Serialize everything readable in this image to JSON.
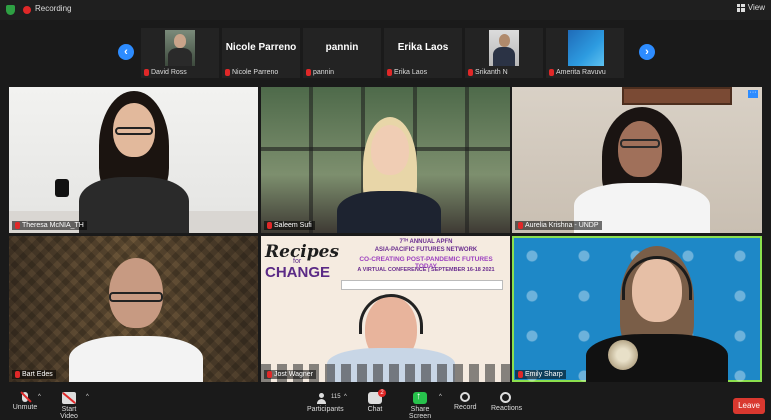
{
  "topbar": {
    "recording_label": "Recording",
    "view_label": "View"
  },
  "strip": {
    "prev_glyph": "‹",
    "next_glyph": "›",
    "tiles": [
      {
        "display": "",
        "label": "David Ross"
      },
      {
        "display": "Nicole Parreno",
        "label": "Nicole Parreno"
      },
      {
        "display": "pannin",
        "label": "pannin"
      },
      {
        "display": "Erika Laos",
        "label": "Erika Laos"
      },
      {
        "display": "",
        "label": "Srikanth N"
      },
      {
        "display": "",
        "label": "Amerita Ravuvu"
      }
    ]
  },
  "videos": [
    {
      "label": "Theresa McNIA_TH"
    },
    {
      "label": "Saleem Sufi"
    },
    {
      "label": "Aurelia Krishna - UNDP"
    },
    {
      "label": "Bart Edes"
    },
    {
      "label": "Jost Wagner"
    },
    {
      "label": "Emily Sharp"
    }
  ],
  "poster": {
    "recipes": "Recipes",
    "for": "for",
    "change": "CHANGE",
    "line1": "7ᵀᴴ ANNUAL APFN",
    "line2": "ASIA-PACIFIC FUTURES NETWORK",
    "line3": "CO-CREATING POST-PANDEMIC FUTURES TODAY",
    "line4": "A VIRTUAL CONFERENCE | SEPTEMBER 16-18 2021"
  },
  "toolbar": {
    "unmute": "Unmute",
    "start_video": "Start Video",
    "participants": "Participants",
    "participants_count": "115",
    "chat": "Chat",
    "chat_badge": "2",
    "share": "Share Screen",
    "record": "Record",
    "reactions": "Reactions",
    "leave": "Leave"
  },
  "colors": {
    "accent": "#2d8cff",
    "leave": "#d9382f",
    "share": "#27c24c",
    "active_speaker": "#8be04e"
  }
}
